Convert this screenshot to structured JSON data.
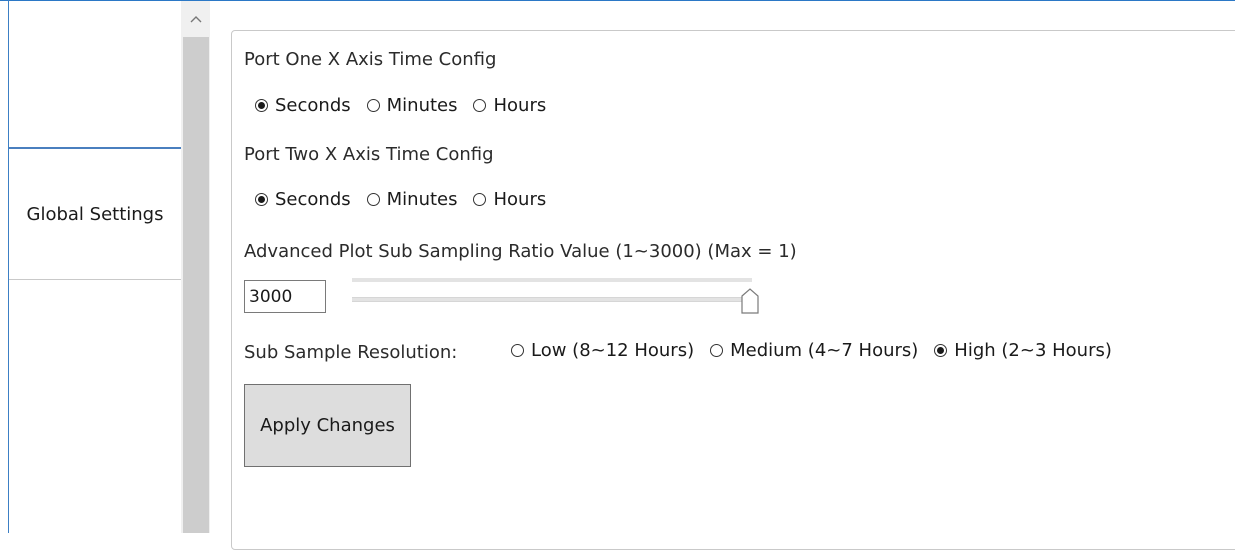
{
  "sidebar": {
    "items": [
      {
        "label": "Global Settings"
      }
    ]
  },
  "port_one": {
    "title": "Port One X Axis Time Config",
    "options": [
      "Seconds",
      "Minutes",
      "Hours"
    ],
    "selected": "Seconds"
  },
  "port_two": {
    "title": "Port Two X Axis Time Config",
    "options": [
      "Seconds",
      "Minutes",
      "Hours"
    ],
    "selected": "Seconds"
  },
  "sub_sampling": {
    "title": "Advanced Plot Sub Sampling Ratio Value (1~3000) (Max = 1)",
    "value": "3000",
    "slider_fraction": 1.0
  },
  "resolution": {
    "label": "Sub Sample Resolution:",
    "options": [
      "Low (8~12 Hours)",
      "Medium (4~7 Hours)",
      "High (2~3 Hours)"
    ],
    "selected": "High (2~3 Hours)"
  },
  "apply_button": {
    "label": "Apply Changes"
  },
  "colors": {
    "window_border": "#2b78c6",
    "button_bg": "#dddddd",
    "scroll_thumb": "#cdcdcd"
  },
  "icons": {
    "scroll_up": "chevron-up-icon",
    "slider_thumb": "slider-thumb-icon"
  }
}
